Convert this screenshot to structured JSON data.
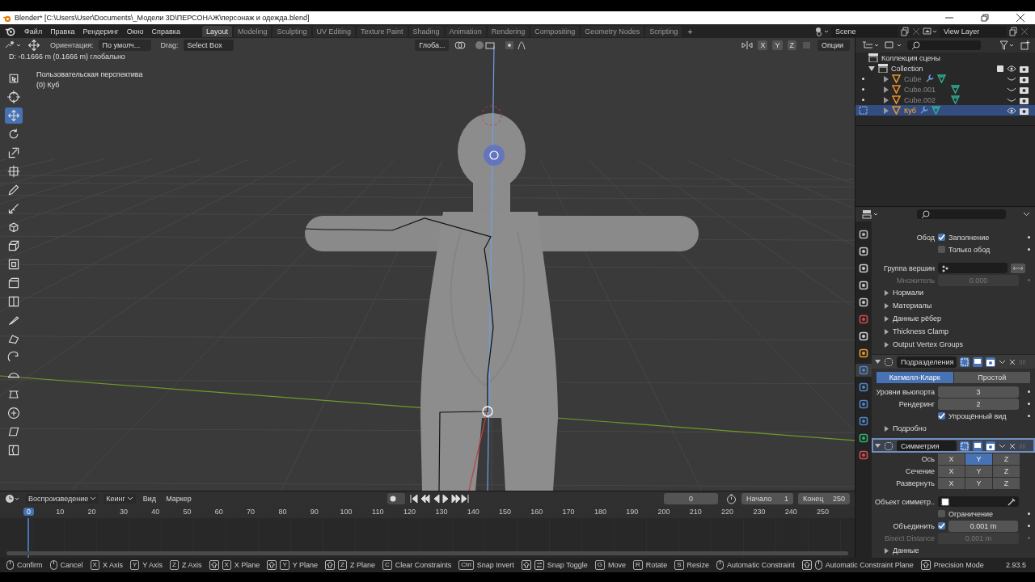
{
  "window": {
    "title": "Blender* [C:\\Users\\User\\Documents\\_Модели 3D\\ПЕРСОНАЖ\\персонаж и одежда.blend]"
  },
  "menu": [
    "Файл",
    "Правка",
    "Рендеринг",
    "Окно",
    "Справка"
  ],
  "workspaces": [
    {
      "label": "Layout",
      "selected": true
    },
    {
      "label": "Modeling",
      "selected": false
    },
    {
      "label": "Sculpting",
      "selected": false
    },
    {
      "label": "UV Editing",
      "selected": false
    },
    {
      "label": "Texture Paint",
      "selected": false
    },
    {
      "label": "Shading",
      "selected": false
    },
    {
      "label": "Animation",
      "selected": false
    },
    {
      "label": "Rendering",
      "selected": false
    },
    {
      "label": "Compositing",
      "selected": false
    },
    {
      "label": "Geometry Nodes",
      "selected": false
    },
    {
      "label": "Scripting",
      "selected": false
    }
  ],
  "add_workspace": "+",
  "scene": "Scene",
  "view_layer": "View Layer",
  "viewport_header": {
    "orientation_label": "Ориентация:",
    "orientation": "По умолч...",
    "drag_label": "Drag:",
    "drag": "Select Box",
    "transform": "Глоба...",
    "axes": [
      "X",
      "Y",
      "Z"
    ],
    "options": "Опции"
  },
  "viewport": {
    "status": "D: -0.1666 m (0.1666 m) глобально",
    "view_name": "Пользовательская перспектива",
    "object": "(0) Куб"
  },
  "tools": [
    {
      "kind": "select",
      "selected": false
    },
    {
      "kind": "cursor",
      "selected": false
    },
    {
      "kind": "move",
      "selected": true
    },
    {
      "kind": "rotate",
      "selected": false
    },
    {
      "kind": "scale",
      "selected": false
    },
    {
      "kind": "transform",
      "selected": false
    },
    {
      "kind": "annotate",
      "selected": false
    },
    {
      "kind": "measure",
      "selected": false
    },
    {
      "kind": "add",
      "selected": false
    },
    {
      "kind": "extrude",
      "selected": false
    },
    {
      "kind": "inset",
      "selected": false
    },
    {
      "kind": "bevel",
      "selected": false
    },
    {
      "kind": "loopcut",
      "selected": false
    },
    {
      "kind": "knife",
      "selected": false
    },
    {
      "kind": "polybuild",
      "selected": false
    },
    {
      "kind": "spin",
      "selected": false
    },
    {
      "kind": "smooth",
      "selected": false
    },
    {
      "kind": "slide",
      "selected": false
    },
    {
      "kind": "shrink",
      "selected": false
    },
    {
      "kind": "shear",
      "selected": false
    },
    {
      "kind": "rip",
      "selected": false
    }
  ],
  "outliner": {
    "root": "Коллекция сцены",
    "collection": {
      "name": "Collection",
      "expanded": true,
      "checked": true,
      "children": [
        {
          "name": "Cube",
          "selected": false,
          "visible": false,
          "modifier": true
        },
        {
          "name": "Cube.001",
          "selected": false,
          "visible": false,
          "modifier": false
        },
        {
          "name": "Cube.002",
          "selected": false,
          "visible": false,
          "modifier": false
        },
        {
          "name": "Куб",
          "selected": true,
          "visible": true,
          "modifier": true
        }
      ]
    }
  },
  "property_tabs": [
    {
      "kind": "tool",
      "selected": false
    },
    {
      "kind": "render",
      "selected": false
    },
    {
      "kind": "output",
      "selected": false
    },
    {
      "kind": "view_layer",
      "selected": false
    },
    {
      "kind": "scene",
      "selected": false
    },
    {
      "kind": "world",
      "selected": false
    },
    {
      "kind": "collection",
      "selected": false
    },
    {
      "kind": "object",
      "selected": false
    },
    {
      "kind": "modifier",
      "selected": true
    },
    {
      "kind": "particles",
      "selected": false
    },
    {
      "kind": "physics",
      "selected": false
    },
    {
      "kind": "constraints",
      "selected": false
    },
    {
      "kind": "data",
      "selected": false
    },
    {
      "kind": "material",
      "selected": false
    }
  ],
  "properties": [
    {
      "kind": "checkbox",
      "side_label": "Обод",
      "label": "Заполнение",
      "checked": true
    },
    {
      "kind": "checkbox",
      "label": "Только обод",
      "checked": false
    },
    {
      "kind": "group_field",
      "label": "Группа вершин"
    },
    {
      "kind": "number",
      "label": "Множитель",
      "value": "0.000",
      "disabled": true
    },
    {
      "kind": "subpanel",
      "label": "Нормали"
    },
    {
      "kind": "subpanel",
      "label": "Материалы"
    },
    {
      "kind": "subpanel",
      "label": "Данные рёбер"
    },
    {
      "kind": "subpanel",
      "label": "Thickness Clamp"
    },
    {
      "kind": "subpanel",
      "label": "Output Vertex Groups"
    },
    {
      "kind": "modifier",
      "name": "Подразделения",
      "active": false
    },
    {
      "kind": "segmented",
      "options": [
        {
          "label": "Катмелл-Кларк",
          "selected": true
        },
        {
          "label": "Простой",
          "selected": false
        }
      ]
    },
    {
      "kind": "number",
      "label": "Уровни вьюпорта",
      "value": "3",
      "disabled": false
    },
    {
      "kind": "number",
      "label": "Рендеринг",
      "value": "2",
      "disabled": false
    },
    {
      "kind": "checkbox",
      "label": "Упрощённый вид",
      "checked": true
    },
    {
      "kind": "subpanel",
      "label": "Подробно"
    },
    {
      "kind": "modifier",
      "name": "Симметрия",
      "active": true
    },
    {
      "kind": "axes",
      "label": "Ось",
      "options": [
        {
          "label": "X",
          "selected": false
        },
        {
          "label": "Y",
          "selected": true
        },
        {
          "label": "Z",
          "selected": false
        }
      ]
    },
    {
      "kind": "axes",
      "label": "Сечение",
      "options": [
        {
          "label": "X",
          "selected": false
        },
        {
          "label": "Y",
          "selected": false
        },
        {
          "label": "Z",
          "selected": false
        }
      ]
    },
    {
      "kind": "axes",
      "label": "Развернуть",
      "options": [
        {
          "label": "X",
          "selected": false
        },
        {
          "label": "Y",
          "selected": false
        },
        {
          "label": "Z",
          "selected": false
        }
      ]
    },
    {
      "kind": "object_field",
      "label": "Объект симметр.."
    },
    {
      "kind": "checkbox",
      "label": "Ограничение",
      "checked": false
    },
    {
      "kind": "check_number",
      "label": "Объединить",
      "checked": true,
      "value": "0.001 m"
    },
    {
      "kind": "number",
      "label": "Bisect Distance",
      "value": "0.001 m",
      "disabled": true
    },
    {
      "kind": "subpanel",
      "label": "Данные"
    }
  ],
  "timeline": {
    "menus": [
      {
        "label": "Воспроизведение",
        "dropdown": true
      },
      {
        "label": "Кеинг",
        "dropdown": true
      },
      {
        "label": "Вид",
        "dropdown": false
      },
      {
        "label": "Маркер",
        "dropdown": false
      }
    ],
    "current_frame": "0",
    "start_label": "Начало",
    "start": "1",
    "end_label": "Конец",
    "end": "250",
    "ruler": [
      {
        "label": "0",
        "selected": true
      },
      {
        "label": "10",
        "selected": false
      },
      {
        "label": "20",
        "selected": false
      },
      {
        "label": "30",
        "selected": false
      },
      {
        "label": "40",
        "selected": false
      },
      {
        "label": "50",
        "selected": false
      },
      {
        "label": "60",
        "selected": false
      },
      {
        "label": "70",
        "selected": false
      },
      {
        "label": "80",
        "selected": false
      },
      {
        "label": "90",
        "selected": false
      },
      {
        "label": "100",
        "selected": false
      },
      {
        "label": "110",
        "selected": false
      },
      {
        "label": "120",
        "selected": false
      },
      {
        "label": "130",
        "selected": false
      },
      {
        "label": "140",
        "selected": false
      },
      {
        "label": "150",
        "selected": false
      },
      {
        "label": "160",
        "selected": false
      },
      {
        "label": "170",
        "selected": false
      },
      {
        "label": "180",
        "selected": false
      },
      {
        "label": "190",
        "selected": false
      },
      {
        "label": "200",
        "selected": false
      },
      {
        "label": "210",
        "selected": false
      },
      {
        "label": "220",
        "selected": false
      },
      {
        "label": "230",
        "selected": false
      },
      {
        "label": "240",
        "selected": false
      },
      {
        "label": "250",
        "selected": false
      }
    ]
  },
  "status_bar": {
    "hints": [
      {
        "keys": [
          {
            "kind": "mouse"
          }
        ],
        "label": "Confirm"
      },
      {
        "keys": [
          {
            "kind": "mouse"
          }
        ],
        "label": "Cancel"
      },
      {
        "keys": [
          {
            "kind": "key",
            "text": "X"
          }
        ],
        "label": "X Axis"
      },
      {
        "keys": [
          {
            "kind": "key",
            "text": "Y"
          }
        ],
        "label": "Y Axis"
      },
      {
        "keys": [
          {
            "kind": "key",
            "text": "Z"
          }
        ],
        "label": "Z Axis"
      },
      {
        "keys": [
          {
            "kind": "shift"
          },
          {
            "kind": "key",
            "text": "X"
          }
        ],
        "label": "X Plane"
      },
      {
        "keys": [
          {
            "kind": "shift"
          },
          {
            "kind": "key",
            "text": "Y"
          }
        ],
        "label": "Y Plane"
      },
      {
        "keys": [
          {
            "kind": "shift"
          },
          {
            "kind": "key",
            "text": "Z"
          }
        ],
        "label": "Z Plane"
      },
      {
        "keys": [
          {
            "kind": "key",
            "text": "C"
          }
        ],
        "label": "Clear Constraints"
      },
      {
        "keys": [
          {
            "kind": "key",
            "text": "Ctrl"
          }
        ],
        "label": "Snap Invert"
      },
      {
        "keys": [
          {
            "kind": "shift"
          },
          {
            "kind": "tab"
          }
        ],
        "label": "Snap Toggle"
      },
      {
        "keys": [
          {
            "kind": "key",
            "text": "G"
          }
        ],
        "label": "Move"
      },
      {
        "keys": [
          {
            "kind": "key",
            "text": "R"
          }
        ],
        "label": "Rotate"
      },
      {
        "keys": [
          {
            "kind": "key",
            "text": "S"
          }
        ],
        "label": "Resize"
      },
      {
        "keys": [
          {
            "kind": "mouse"
          }
        ],
        "label": "Automatic Constraint"
      },
      {
        "keys": [
          {
            "kind": "shift"
          },
          {
            "kind": "mouse"
          }
        ],
        "label": "Automatic Constraint Plane"
      },
      {
        "keys": [
          {
            "kind": "shift"
          }
        ],
        "label": "Precision Mode"
      }
    ],
    "version": "2.93.5"
  }
}
